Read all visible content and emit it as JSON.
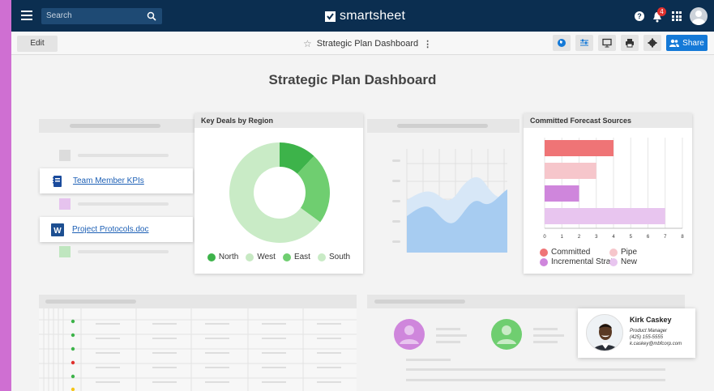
{
  "topbar": {
    "search_placeholder": "Search",
    "brand": "smartsheet",
    "notification_count": "4",
    "share_label": "Share"
  },
  "toolbar": {
    "edit_label": "Edit",
    "doc_title": "Strategic Plan Dashboard"
  },
  "dashboard": {
    "title": "Strategic Plan Dashboard",
    "links": [
      {
        "label": "Team Member KPIs",
        "icon": "notebook-icon"
      },
      {
        "label": "Project Protocols.doc",
        "icon": "word-icon"
      }
    ],
    "contact": {
      "name": "Kirk Caskey",
      "title": "Product Manager",
      "phone": "(425) 155-5555",
      "email": "k.caskey@mbfcorp.com"
    }
  },
  "chart_data": [
    {
      "type": "pie",
      "title": "Key Deals by Region",
      "labels": [
        "North",
        "West",
        "East",
        "South"
      ],
      "values": [
        12,
        0,
        23,
        65
      ],
      "colors": [
        "#3db34a",
        "#c7e9c3",
        "#6fce70",
        "#c9ebc6"
      ],
      "legend": "bottom"
    },
    {
      "type": "bar",
      "orientation": "horizontal",
      "title": "Committed Forecast Sources",
      "categories": [
        "Committed",
        "Pipe",
        "Incremental Strat.",
        "New"
      ],
      "values": [
        4,
        3,
        2,
        7
      ],
      "colors": [
        "#ef7476",
        "#f6c6cb",
        "#cf86dc",
        "#e8c5ef"
      ],
      "xlim": [
        0,
        8
      ],
      "xticks": [
        "0",
        "1",
        "2",
        "3",
        "4",
        "5",
        "6",
        "7",
        "8"
      ],
      "legend": "bottom"
    }
  ],
  "colors": {
    "topbar": "#0b2e50",
    "accent": "#1479d7",
    "outer": "#cf6fd2"
  }
}
